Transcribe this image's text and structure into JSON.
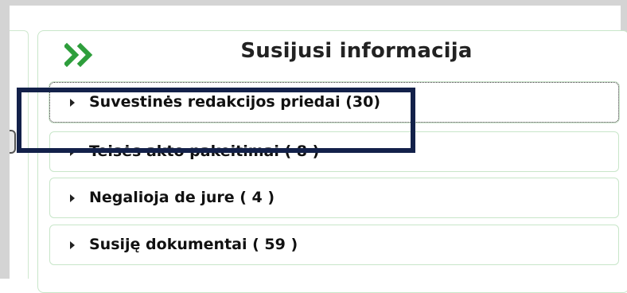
{
  "panel": {
    "title": "Susijusi informacija",
    "icon": "double-chevron-right-icon",
    "accent_color": "#2e9e3c"
  },
  "items": [
    {
      "label": "Suvestinės redakcijos priedai (30)",
      "focused": true
    },
    {
      "label": "Teisės akto pakeitimai ( 8 )",
      "focused": false
    },
    {
      "label": "Negalioja de jure ( 4 )",
      "focused": false
    },
    {
      "label": "Susiję dokumentai ( 59 )",
      "focused": false
    }
  ],
  "highlight_color": "#13214a"
}
